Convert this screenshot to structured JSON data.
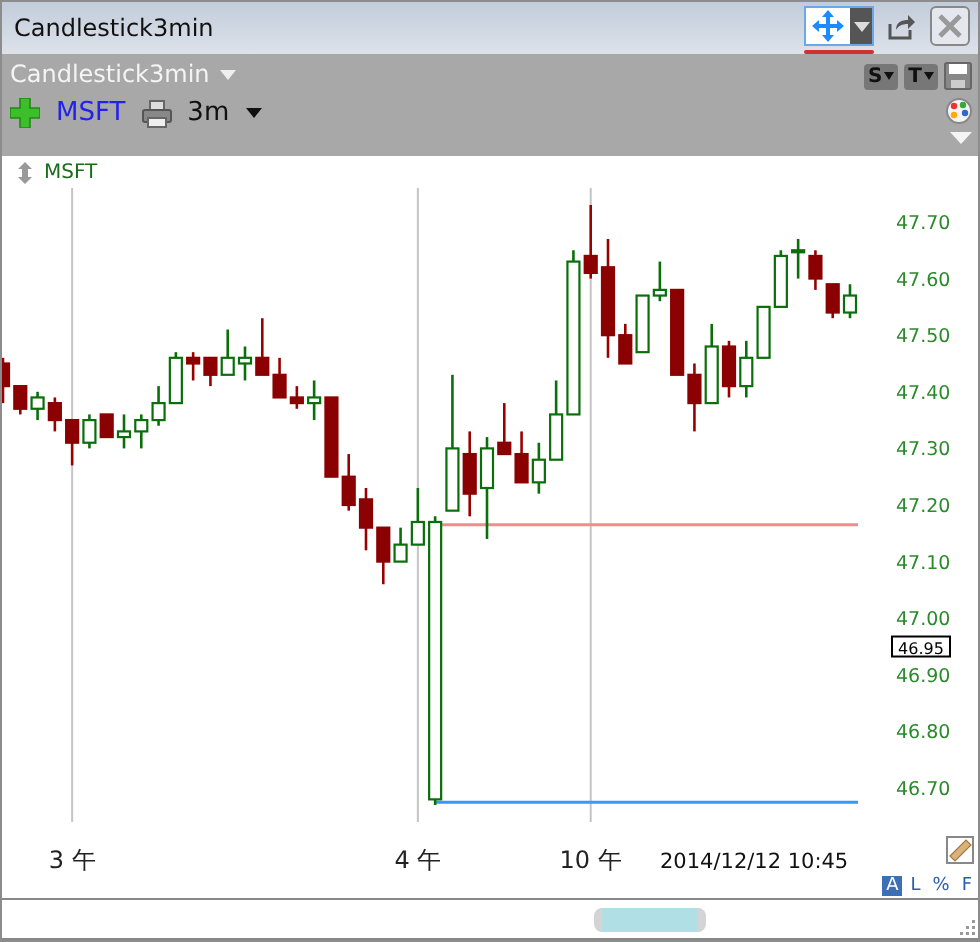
{
  "window": {
    "title": "Candlestick3min"
  },
  "toolbar": {
    "chart_name": "Candlestick3min",
    "symbol": "MSFT",
    "interval": "3m",
    "buttons": [
      {
        "label": "S"
      },
      {
        "label": "T"
      }
    ]
  },
  "chart": {
    "legend": "MSFT",
    "timestamp": "2014/12/12 10:45",
    "price_marker": "46.95",
    "chart_data": {
      "type": "candlestick",
      "categories": [
        null,
        null,
        null,
        null,
        "3 午",
        null,
        null,
        null,
        null,
        null,
        null,
        null,
        null,
        null,
        null,
        null,
        null,
        null,
        null,
        null,
        null,
        null,
        null,
        null,
        "4 午",
        null,
        null,
        null,
        null,
        null,
        null,
        null,
        null,
        null,
        "10 午",
        null,
        null,
        null,
        null,
        null,
        null,
        null,
        null,
        null,
        null,
        null,
        null,
        null,
        null,
        null
      ],
      "grid": true,
      "ylim": [
        46.64,
        47.76
      ],
      "ref_lines": [
        {
          "axis": "y",
          "value": 47.165,
          "color": "#f08c8c"
        },
        {
          "axis": "y",
          "value": 46.675,
          "color": "#3399ff"
        }
      ],
      "yticks": [
        {
          "value": 47.7,
          "label": "47.70"
        },
        {
          "value": 47.6,
          "label": "47.60"
        },
        {
          "value": 47.5,
          "label": "47.50"
        },
        {
          "value": 47.4,
          "label": "47.40"
        },
        {
          "value": 47.3,
          "label": "47.30"
        },
        {
          "value": 47.2,
          "label": "47.20"
        },
        {
          "value": 47.1,
          "label": "47.10"
        },
        {
          "value": 47.0,
          "label": "47.00"
        },
        {
          "value": 46.9,
          "label": "46.90"
        },
        {
          "value": 46.8,
          "label": "46.80"
        },
        {
          "value": 46.7,
          "label": "46.70"
        }
      ],
      "ohlc": [
        [
          47.45,
          47.46,
          47.38,
          47.41
        ],
        [
          47.41,
          47.41,
          47.36,
          47.37
        ],
        [
          47.37,
          47.4,
          47.35,
          47.39
        ],
        [
          47.38,
          47.39,
          47.33,
          47.35
        ],
        [
          47.35,
          47.35,
          47.27,
          47.31
        ],
        [
          47.31,
          47.36,
          47.3,
          47.35
        ],
        [
          47.36,
          47.36,
          47.32,
          47.32
        ],
        [
          47.32,
          47.36,
          47.3,
          47.33
        ],
        [
          47.33,
          47.36,
          47.3,
          47.35
        ],
        [
          47.35,
          47.41,
          47.34,
          47.38
        ],
        [
          47.38,
          47.47,
          47.38,
          47.46
        ],
        [
          47.46,
          47.47,
          47.42,
          47.45
        ],
        [
          47.46,
          47.46,
          47.41,
          47.43
        ],
        [
          47.43,
          47.51,
          47.43,
          47.46
        ],
        [
          47.45,
          47.48,
          47.42,
          47.46
        ],
        [
          47.46,
          47.53,
          47.43,
          47.43
        ],
        [
          47.43,
          47.46,
          47.39,
          47.39
        ],
        [
          47.39,
          47.41,
          47.37,
          47.38
        ],
        [
          47.38,
          47.42,
          47.35,
          47.39
        ],
        [
          47.39,
          47.39,
          47.25,
          47.25
        ],
        [
          47.25,
          47.29,
          47.19,
          47.2
        ],
        [
          47.21,
          47.23,
          47.12,
          47.16
        ],
        [
          47.16,
          47.16,
          47.06,
          47.1
        ],
        [
          47.1,
          47.16,
          47.1,
          47.13
        ],
        [
          47.13,
          47.23,
          47.13,
          47.17
        ],
        [
          46.68,
          47.18,
          46.67,
          47.17
        ],
        [
          47.19,
          47.43,
          47.19,
          47.3
        ],
        [
          47.29,
          47.33,
          47.18,
          47.22
        ],
        [
          47.23,
          47.32,
          47.14,
          47.3
        ],
        [
          47.31,
          47.38,
          47.29,
          47.29
        ],
        [
          47.29,
          47.33,
          47.24,
          47.24
        ],
        [
          47.24,
          47.31,
          47.22,
          47.28
        ],
        [
          47.28,
          47.42,
          47.28,
          47.36
        ],
        [
          47.36,
          47.65,
          47.36,
          47.63
        ],
        [
          47.64,
          47.73,
          47.6,
          47.61
        ],
        [
          47.62,
          47.67,
          47.46,
          47.5
        ],
        [
          47.5,
          47.52,
          47.45,
          47.45
        ],
        [
          47.47,
          47.57,
          47.47,
          47.57
        ],
        [
          47.57,
          47.63,
          47.56,
          47.58
        ],
        [
          47.58,
          47.58,
          47.43,
          47.43
        ],
        [
          47.43,
          47.45,
          47.33,
          47.38
        ],
        [
          47.38,
          47.52,
          47.38,
          47.48
        ],
        [
          47.48,
          47.49,
          47.39,
          47.41
        ],
        [
          47.41,
          47.49,
          47.39,
          47.46
        ],
        [
          47.46,
          47.55,
          47.46,
          47.55
        ],
        [
          47.55,
          47.65,
          47.55,
          47.64
        ],
        [
          47.65,
          47.67,
          47.6,
          47.65
        ],
        [
          47.64,
          47.65,
          47.58,
          47.6
        ],
        [
          47.59,
          47.59,
          47.53,
          47.54
        ],
        [
          47.54,
          47.59,
          47.53,
          47.57
        ]
      ]
    }
  },
  "scale_modes": [
    {
      "label": "A",
      "selected": true
    },
    {
      "label": "L",
      "selected": false
    },
    {
      "label": "%",
      "selected": false
    },
    {
      "label": "F",
      "selected": false
    }
  ]
}
